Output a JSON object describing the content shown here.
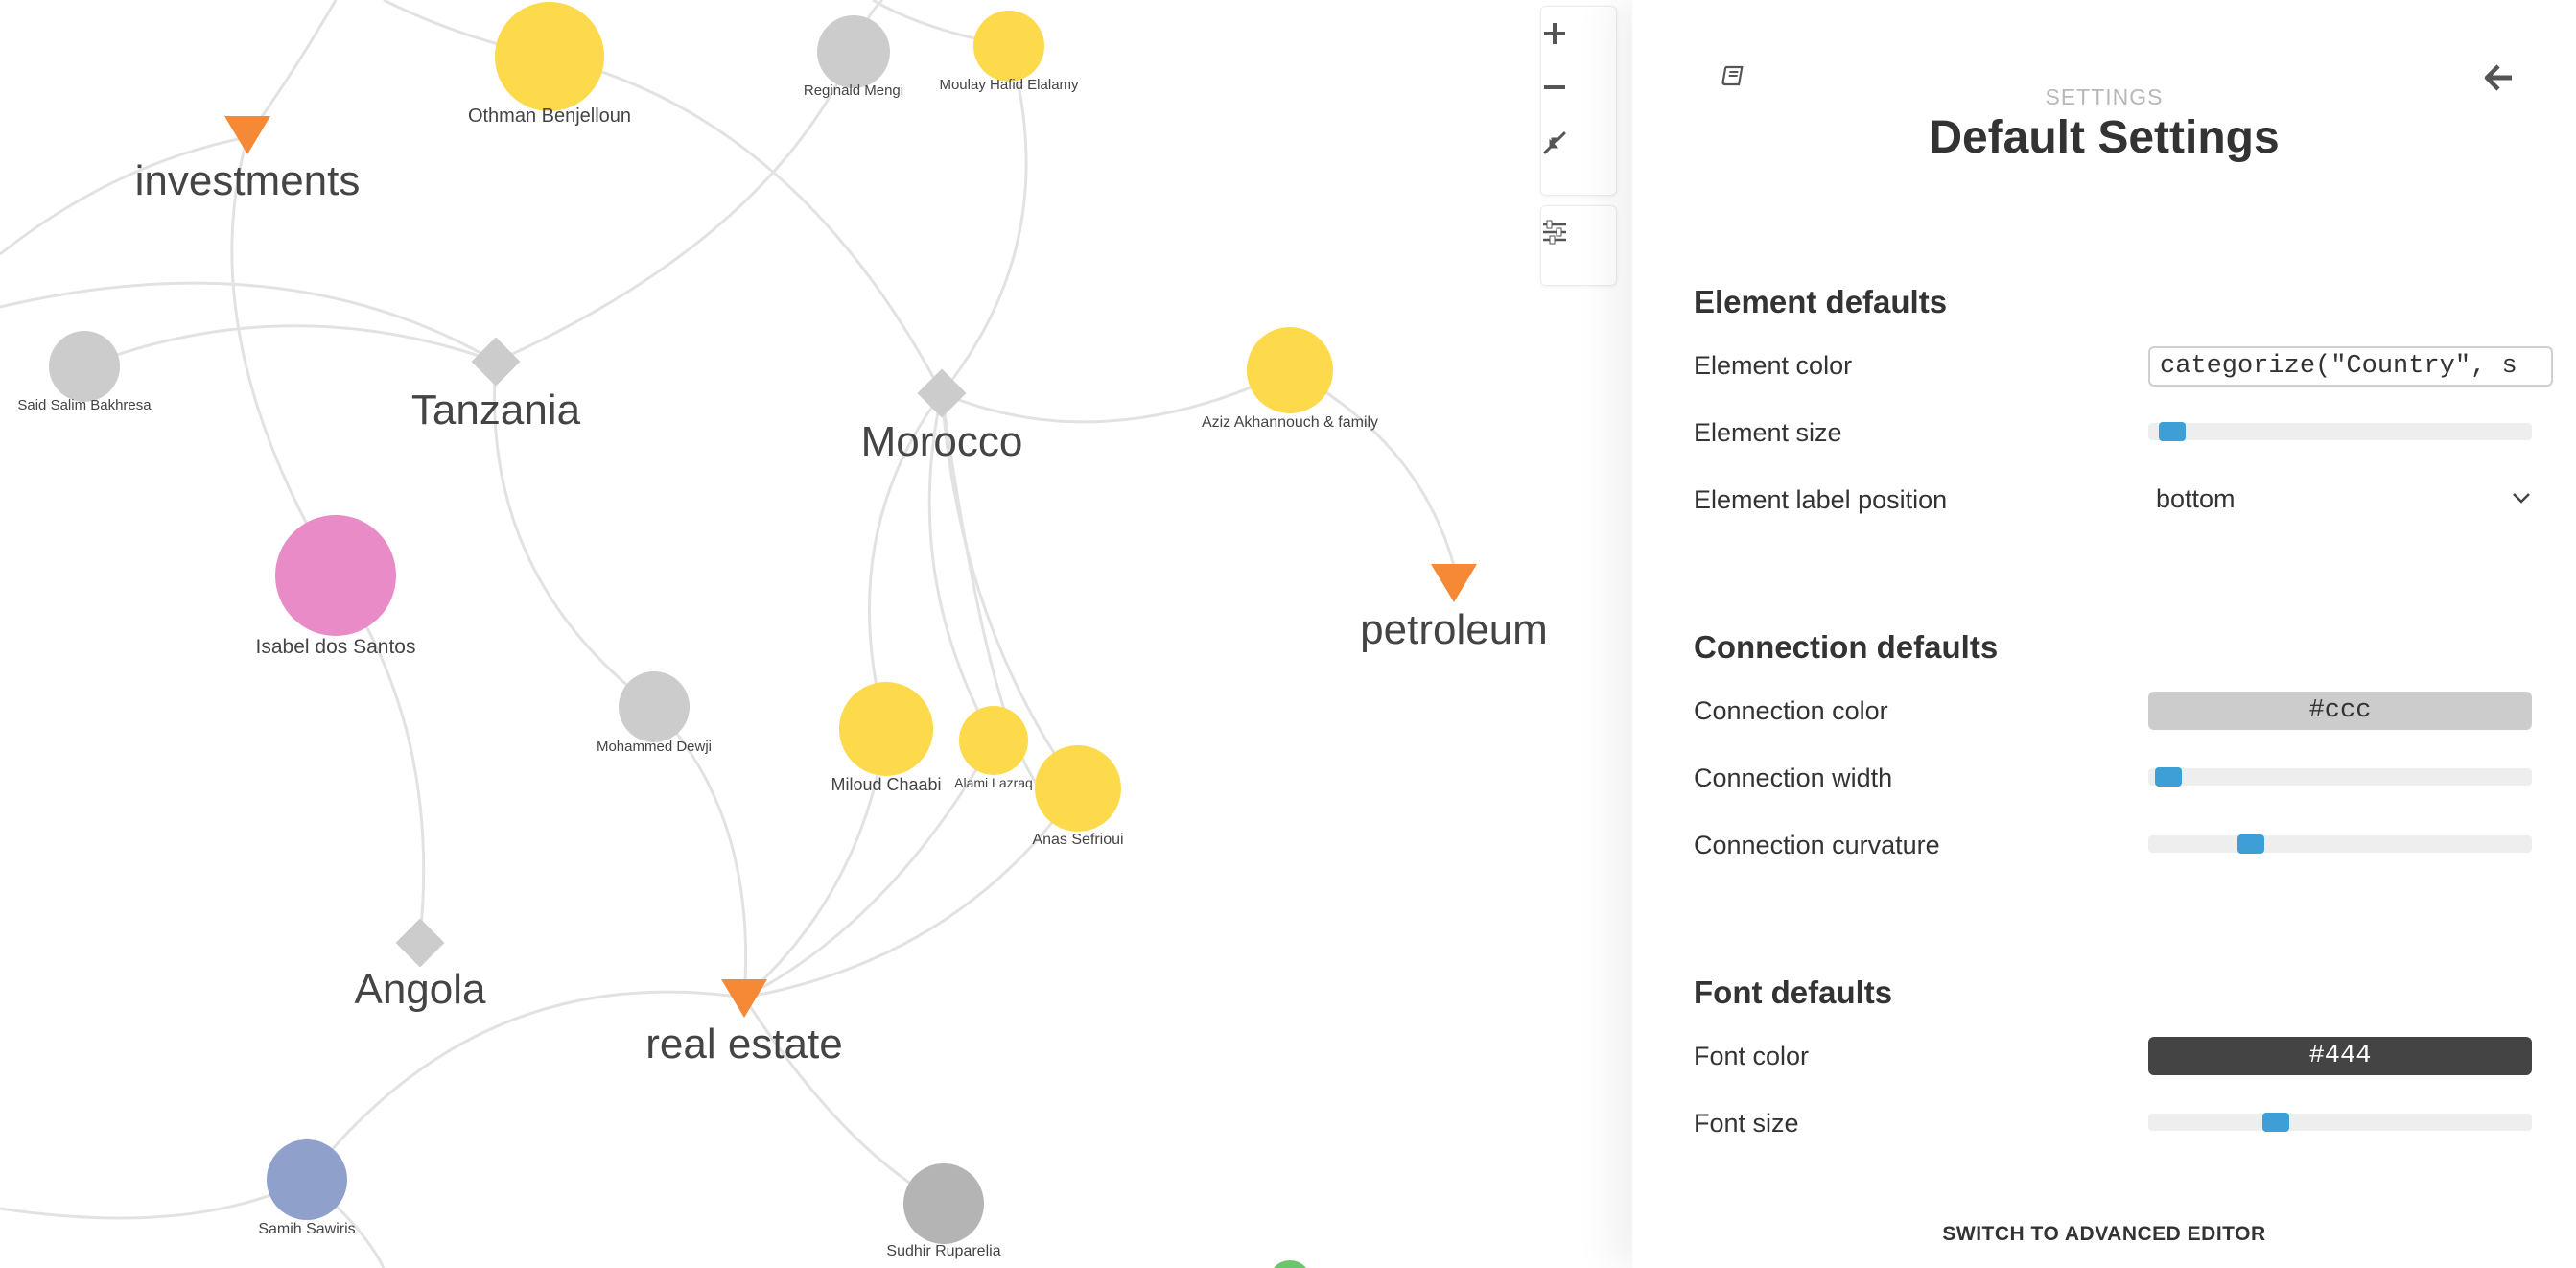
{
  "graph": {
    "nodes": [
      {
        "id": "othman",
        "label": "Othman Benjelloun",
        "shape": "circle",
        "color": "#fdd94c",
        "size": "large"
      },
      {
        "id": "reginald",
        "label": "Reginald Mengi",
        "shape": "circle",
        "color": "#cccccc",
        "size": "medium"
      },
      {
        "id": "moulay",
        "label": "Moulay Hafid Elalamy",
        "shape": "circle",
        "color": "#fdd94c",
        "size": "medium"
      },
      {
        "id": "investments",
        "label": "investments",
        "shape": "triangle",
        "color": "#f58936",
        "size": "small"
      },
      {
        "id": "said",
        "label": "Said Salim Bakhresa",
        "shape": "circle",
        "color": "#cccccc",
        "size": "medium"
      },
      {
        "id": "tanzania",
        "label": "Tanzania",
        "shape": "diamond",
        "color": "#cccccc",
        "size": "small"
      },
      {
        "id": "morocco",
        "label": "Morocco",
        "shape": "diamond",
        "color": "#cccccc",
        "size": "small"
      },
      {
        "id": "aziz",
        "label": "Aziz Akhannouch & family",
        "shape": "circle",
        "color": "#fdd94c",
        "size": "large"
      },
      {
        "id": "petroleum",
        "label": "petroleum",
        "shape": "triangle",
        "color": "#f58936",
        "size": "small"
      },
      {
        "id": "isabel",
        "label": "Isabel dos Santos",
        "shape": "circle",
        "color": "#e88bc6",
        "size": "xlarge"
      },
      {
        "id": "mohammed",
        "label": "Mohammed Dewji",
        "shape": "circle",
        "color": "#cccccc",
        "size": "medium"
      },
      {
        "id": "miloud",
        "label": "Miloud Chaabi",
        "shape": "circle",
        "color": "#fdd94c",
        "size": "large"
      },
      {
        "id": "alami",
        "label": "Alami Lazraq",
        "shape": "circle",
        "color": "#fdd94c",
        "size": "medium"
      },
      {
        "id": "anas",
        "label": "Anas Sefrioui",
        "shape": "circle",
        "color": "#fdd94c",
        "size": "large"
      },
      {
        "id": "angola",
        "label": "Angola",
        "shape": "diamond",
        "color": "#cccccc",
        "size": "small"
      },
      {
        "id": "realestate",
        "label": "real estate",
        "shape": "triangle",
        "color": "#f58936",
        "size": "small"
      },
      {
        "id": "samih",
        "label": "Samih Sawiris",
        "shape": "circle",
        "color": "#8fa0cb",
        "size": "large"
      },
      {
        "id": "sudhir",
        "label": "Sudhir Ruparelia",
        "shape": "circle",
        "color": "#b4b4b4",
        "size": "large"
      }
    ],
    "edge_color": "#e0e0e0"
  },
  "controls": {
    "zoom_in": "plus-icon",
    "zoom_out": "minus-icon",
    "fit": "compress-arrows-icon",
    "filter": "sliders-icon"
  },
  "panel": {
    "eyebrow": "SETTINGS",
    "title": "Default Settings",
    "sections": {
      "element": {
        "title": "Element defaults",
        "color_label": "Element color",
        "color_value": "categorize(\"Country\", s",
        "size_label": "Element size",
        "size_value": 0.03,
        "label_position_label": "Element label position",
        "label_position_value": "bottom"
      },
      "connection": {
        "title": "Connection defaults",
        "color_label": "Connection color",
        "color_value": "#ccc",
        "width_label": "Connection width",
        "width_value": 0.02,
        "curvature_label": "Connection curvature",
        "curvature_value": 0.25
      },
      "font": {
        "title": "Font defaults",
        "color_label": "Font color",
        "color_value": "#444",
        "size_label": "Font size",
        "size_value": 0.32
      }
    },
    "advanced_link": "SWITCH TO ADVANCED EDITOR"
  },
  "colors": {
    "slider_thumb": "#3d9fd6",
    "slider_track": "#eeeeee",
    "connection_swatch": "#cccccc",
    "font_swatch": "#444444"
  }
}
